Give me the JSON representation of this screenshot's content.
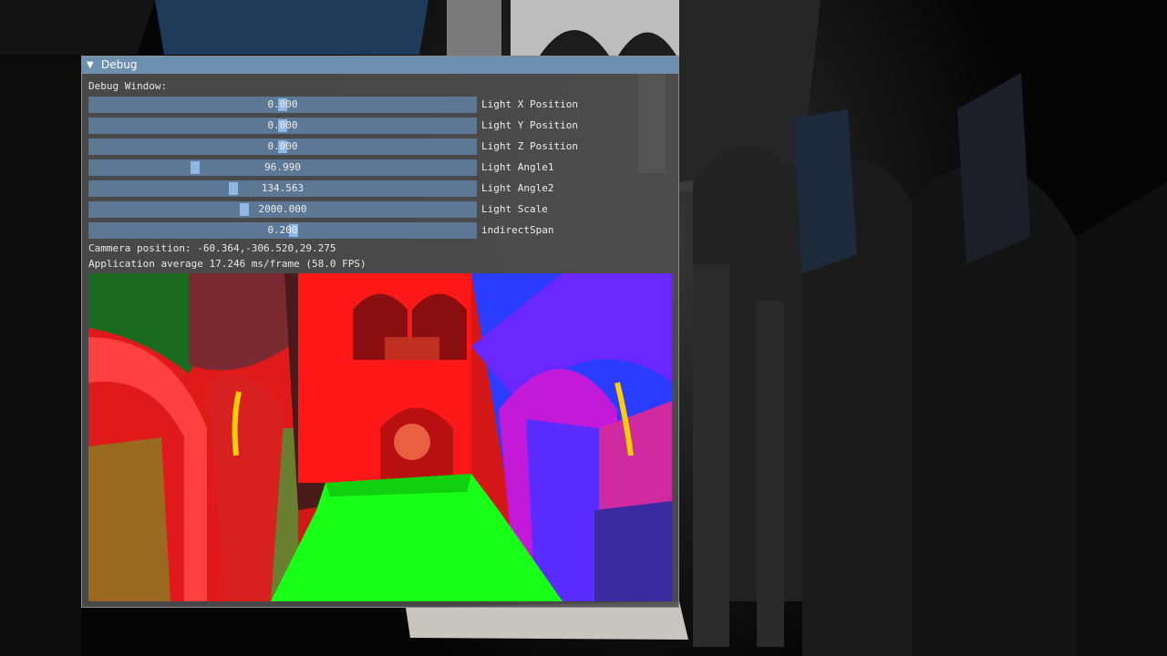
{
  "window": {
    "title": "Debug",
    "heading": "Debug Window:",
    "sliders": [
      {
        "label": "Light X Position",
        "value": "0.000",
        "fraction": 0.5
      },
      {
        "label": "Light Y Position",
        "value": "0.000",
        "fraction": 0.5
      },
      {
        "label": "Light Z Position",
        "value": "0.000",
        "fraction": 0.5
      },
      {
        "label": "Light Angle1",
        "value": "96.990",
        "fraction": 0.27
      },
      {
        "label": "Light Angle2",
        "value": "134.563",
        "fraction": 0.37
      },
      {
        "label": "Light Scale",
        "value": "2000.000",
        "fraction": 0.4
      },
      {
        "label": "indirectSpan",
        "value": "0.200",
        "fraction": 0.53
      }
    ],
    "camera_text": "Cammera position: -60.364,-306.520,29.275",
    "fps_text": "Application average 17.246 ms/frame (58.0 FPS)"
  },
  "icons": {
    "collapse": "triangle-down-icon"
  },
  "colors": {
    "title_bar": "#6d8fb0",
    "slider_track": "#5d7895",
    "slider_grab": "#8fb7e4",
    "normal_red": "#ff1e1e",
    "normal_green": "#18ff18",
    "normal_blue": "#2a3cff"
  }
}
